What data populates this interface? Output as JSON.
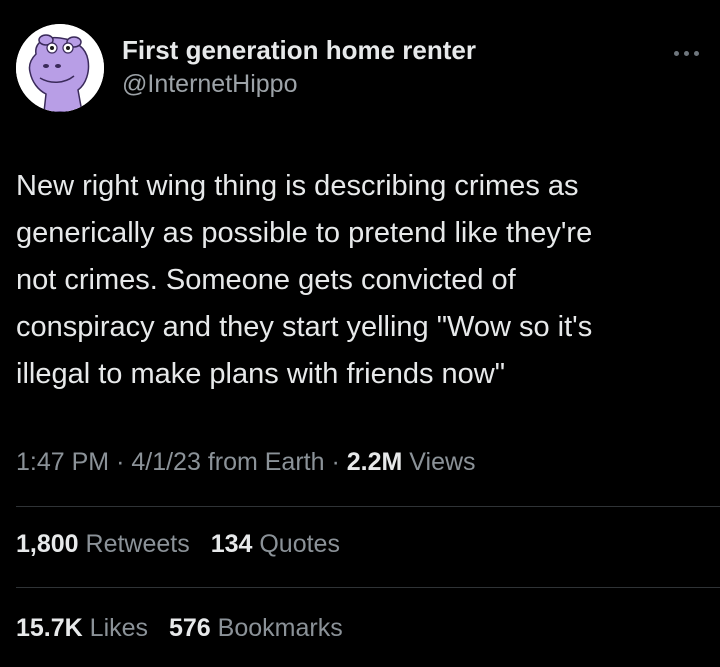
{
  "author": {
    "display_name": "First generation home renter",
    "handle": "@InternetHippo"
  },
  "tweet": {
    "lines": [
      "New right wing thing is describing crimes as",
      "generically as possible to pretend like they're",
      "not crimes. Someone gets convicted of",
      "conspiracy and they start yelling \"Wow so it's",
      "illegal to make plans with friends now\""
    ]
  },
  "meta": {
    "time": "1:47 PM",
    "separator": "·",
    "date": "4/1/23",
    "source": "from Earth",
    "views_count": "2.2M",
    "views_label": "Views"
  },
  "stats": {
    "retweets_count": "1,800",
    "retweets_label": "Retweets",
    "quotes_count": "134",
    "quotes_label": "Quotes",
    "likes_count": "15.7K",
    "likes_label": "Likes",
    "bookmarks_count": "576",
    "bookmarks_label": "Bookmarks"
  },
  "icons": {
    "more": "more-dots-icon",
    "avatar": "hippo-avatar"
  },
  "colors": {
    "background": "#000000",
    "text": "#e7e9ea",
    "secondary_text": "#8b9298",
    "divider": "#2f3336",
    "avatar_hippo": "#b89ee6"
  }
}
